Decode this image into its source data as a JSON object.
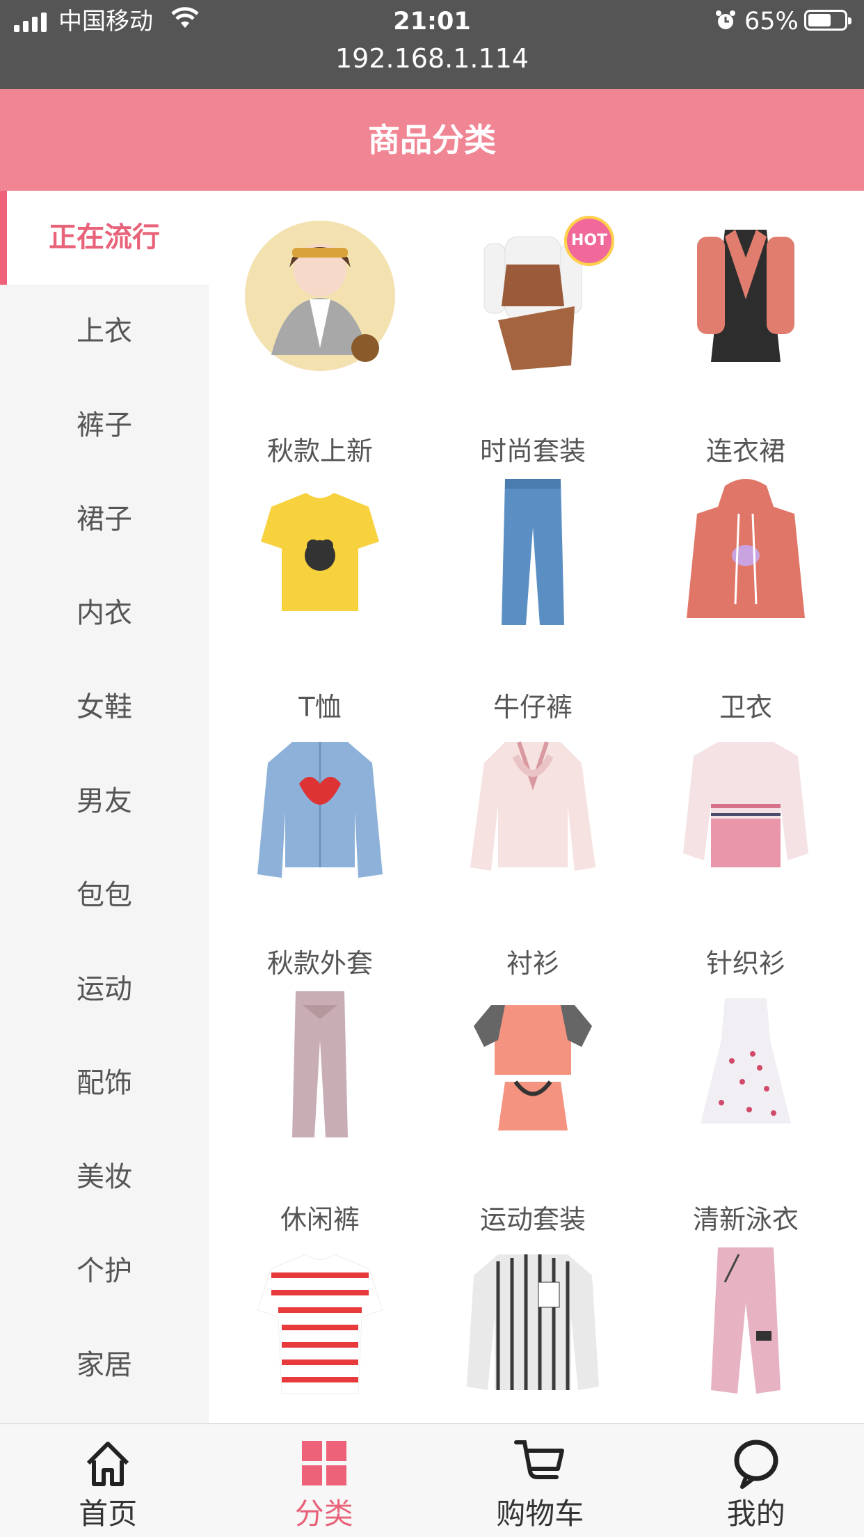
{
  "status": {
    "carrier": "中国移动",
    "time": "21:01",
    "url": "192.168.1.114",
    "battery": "65%",
    "battery_level": 0.65
  },
  "header": {
    "title": "商品分类"
  },
  "sidebar": {
    "items": [
      {
        "label": "正在流行",
        "active": true
      },
      {
        "label": "上衣"
      },
      {
        "label": "裤子"
      },
      {
        "label": "裙子"
      },
      {
        "label": "内衣"
      },
      {
        "label": "女鞋"
      },
      {
        "label": "男友"
      },
      {
        "label": "包包"
      },
      {
        "label": "运动"
      },
      {
        "label": "配饰"
      },
      {
        "label": "美妆"
      },
      {
        "label": "个护"
      },
      {
        "label": "家居"
      }
    ]
  },
  "grid": {
    "hot_badge": "HOT",
    "items": [
      {
        "label": "秋款上新",
        "icon": "portrait-photo-icon"
      },
      {
        "label": "时尚套装",
        "icon": "outfit-set-icon"
      },
      {
        "label": "连衣裙",
        "icon": "dress-icon"
      },
      {
        "label": "T恤",
        "icon": "tshirt-icon"
      },
      {
        "label": "牛仔裤",
        "icon": "jeans-icon"
      },
      {
        "label": "卫衣",
        "icon": "hoodie-icon"
      },
      {
        "label": "秋款外套",
        "icon": "denim-jacket-icon"
      },
      {
        "label": "衬衫",
        "icon": "blouse-icon"
      },
      {
        "label": "针织衫",
        "icon": "knit-sweater-icon"
      },
      {
        "label": "休闲裤",
        "icon": "casual-pants-icon"
      },
      {
        "label": "运动套装",
        "icon": "sport-set-icon"
      },
      {
        "label": "清新泳衣",
        "icon": "swimsuit-icon"
      },
      {
        "label": "",
        "icon": "striped-tee-icon"
      },
      {
        "label": "",
        "icon": "striped-shirt-icon"
      },
      {
        "label": "",
        "icon": "pink-cargo-pants-icon"
      }
    ]
  },
  "tabbar": {
    "items": [
      {
        "label": "首页",
        "icon": "home-icon"
      },
      {
        "label": "分类",
        "icon": "category-grid-icon",
        "active": true
      },
      {
        "label": "购物车",
        "icon": "cart-icon"
      },
      {
        "label": "我的",
        "icon": "profile-icon"
      }
    ]
  },
  "colors": {
    "brand": "#f08594",
    "accent": "#e8637a",
    "status_bar": "#555555"
  }
}
